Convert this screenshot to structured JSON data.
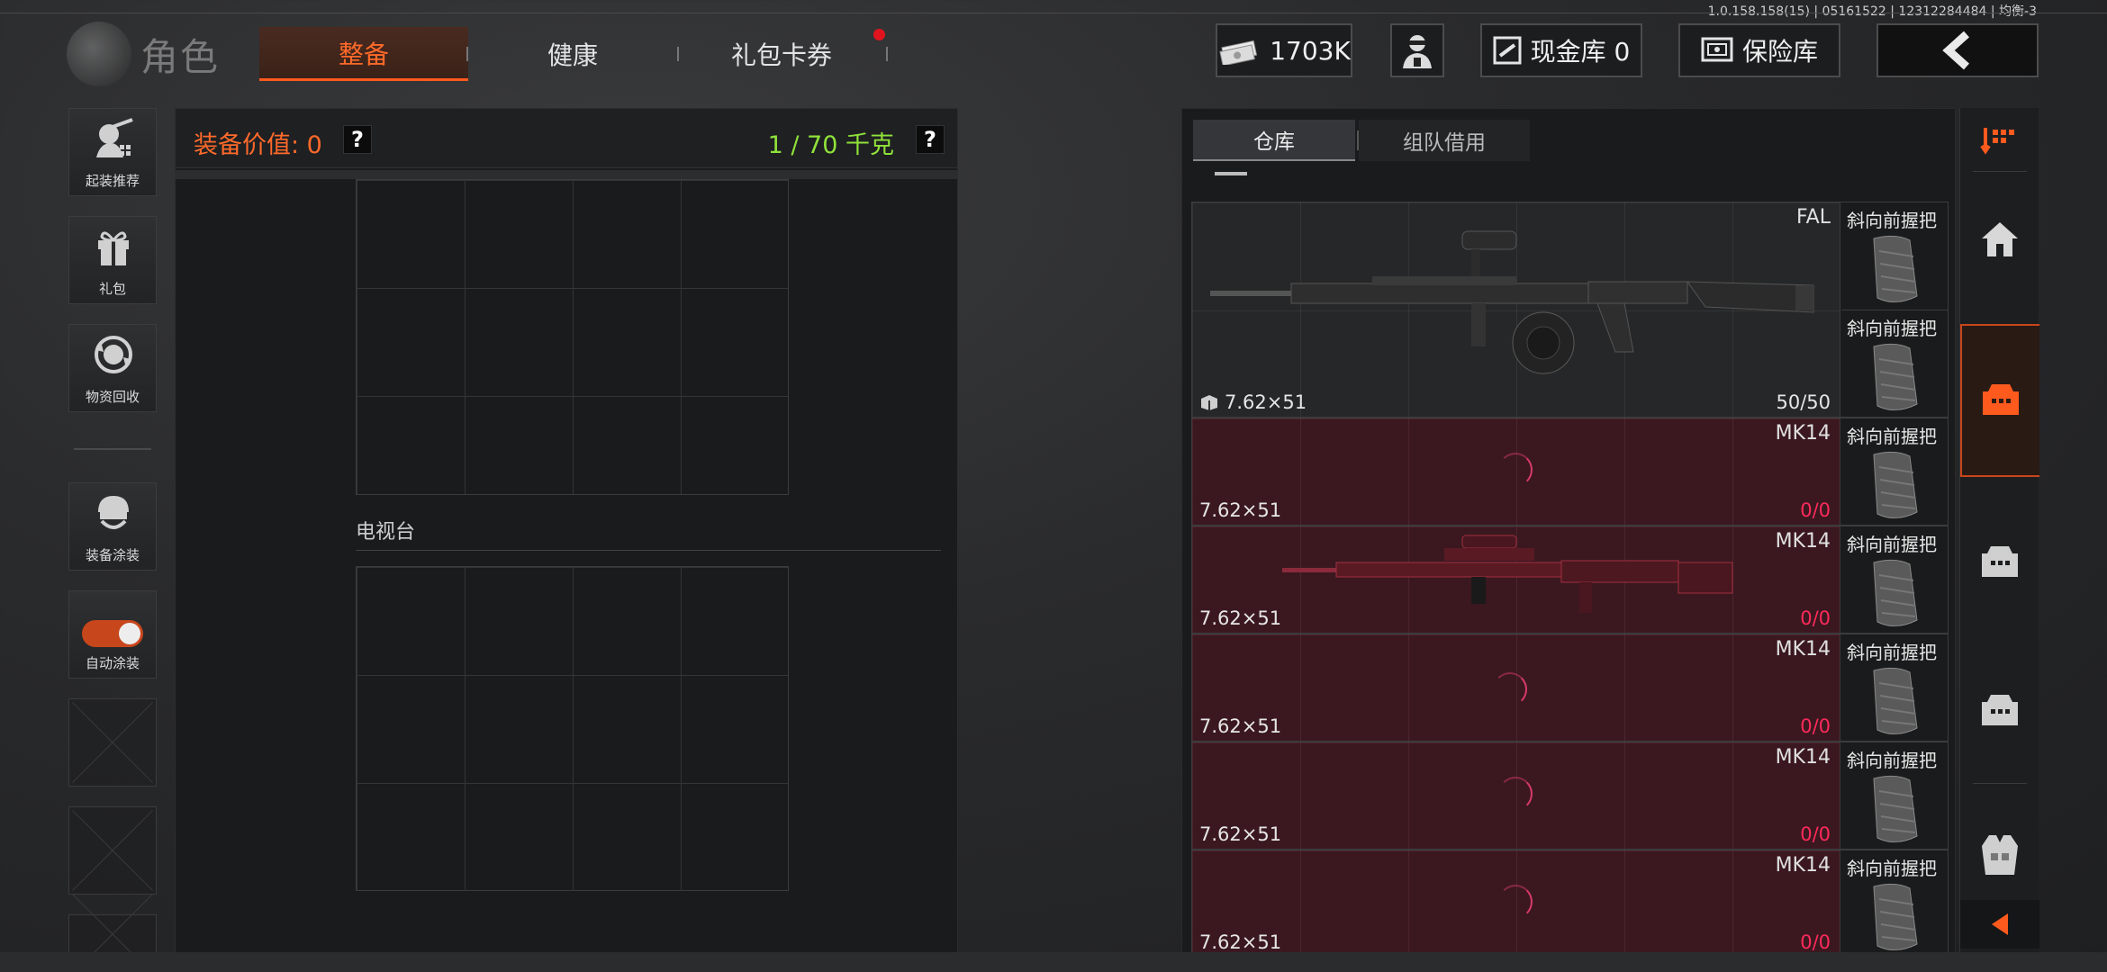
{
  "version_text": "1.0.158.158(15) | 05161522 | 12312284484 | 均衡-3",
  "logo_title": "角色",
  "main_tabs": [
    {
      "label": "整备",
      "active": true
    },
    {
      "label": "健康",
      "active": false
    },
    {
      "label": "礼包卡券",
      "active": false,
      "notification": true
    }
  ],
  "header": {
    "money": "1703K",
    "cash_vault": "现金库 0",
    "safe_box": "保险库"
  },
  "sidebar": {
    "items": [
      {
        "label": "起装推荐",
        "icon": "soldier-gun-icon"
      },
      {
        "label": "礼包",
        "icon": "gift-icon"
      },
      {
        "label": "物资回收",
        "icon": "recycle-icon"
      },
      {
        "label": "装备涂装",
        "icon": "helmet-icon"
      },
      {
        "label": "自动涂装",
        "icon": "toggle",
        "toggle_on": true
      }
    ]
  },
  "equipment": {
    "value_label": "装备价值: 0",
    "weight_label": "1 / 70 千克",
    "help_symbol": "?",
    "section_label": "电视台"
  },
  "warehouse": {
    "tabs": [
      {
        "label": "仓库",
        "active": true
      },
      {
        "label": "组队借用",
        "active": false
      }
    ],
    "weapons": [
      {
        "name": "FAL",
        "caliber": "7.62×51",
        "ammo_current": "50",
        "ammo_max": "/50",
        "style": "dark",
        "attachment": "斜向前握把",
        "attachment2": "斜向前握把"
      },
      {
        "name": "MK14",
        "caliber": "7.62×51",
        "ammo_current": "0",
        "ammo_max": "/0",
        "style": "pink",
        "attachment": "斜向前握把"
      },
      {
        "name": "MK14",
        "caliber": "7.62×51",
        "ammo_current": "0",
        "ammo_max": "/0",
        "style": "pink",
        "attachment": "斜向前握把"
      },
      {
        "name": "MK14",
        "caliber": "7.62×51",
        "ammo_current": "0",
        "ammo_max": "/0",
        "style": "pink",
        "attachment": "斜向前握把"
      },
      {
        "name": "MK14",
        "caliber": "7.62×51",
        "ammo_current": "0",
        "ammo_max": "/0",
        "style": "pink",
        "attachment": "斜向前握把"
      },
      {
        "name": "MK14",
        "caliber": "7.62×51",
        "ammo_current": "0",
        "ammo_max": "/0",
        "style": "pink",
        "attachment": "斜向前握把"
      }
    ]
  },
  "right_nav": [
    "sort-icon",
    "home-icon",
    "storage-box-icon",
    "storage-box-icon",
    "storage-box-icon",
    "vest-icon",
    "collapse-arrow-icon"
  ],
  "colors": {
    "accent": "#ff5a1e",
    "weight": "#8fe23a",
    "alert": "#ff2a5a",
    "dot": "#e0141e"
  }
}
